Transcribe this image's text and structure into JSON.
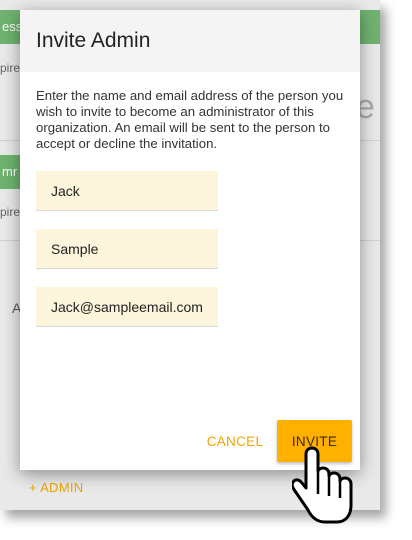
{
  "background": {
    "bar_text_1": "ess",
    "sub_text_1": "pires",
    "big_letter": "e",
    "bar_text_2": "mr",
    "sub_text_2": "pires",
    "letter_a": "A",
    "add_admin_label": "+ ADMIN"
  },
  "dialog": {
    "title": "Invite Admin",
    "description": "Enter the name and email address of the person you wish to invite to become an administrator of this organization. An email will be sent to the person to accept or decline the invitation.",
    "first_name_value": "Jack",
    "last_name_value": "Sample",
    "email_value": "Jack@sampleemail.com",
    "cancel_label": "CANCEL",
    "invite_label": "INVITE"
  },
  "colors": {
    "accent": "#ffb000",
    "link": "#f0a400",
    "field_bg": "#fdf6dc",
    "header_bg": "#f4f4f4",
    "bg_bar": "#6fb36f"
  },
  "icons": {
    "cursor": "hand-pointer-icon"
  }
}
